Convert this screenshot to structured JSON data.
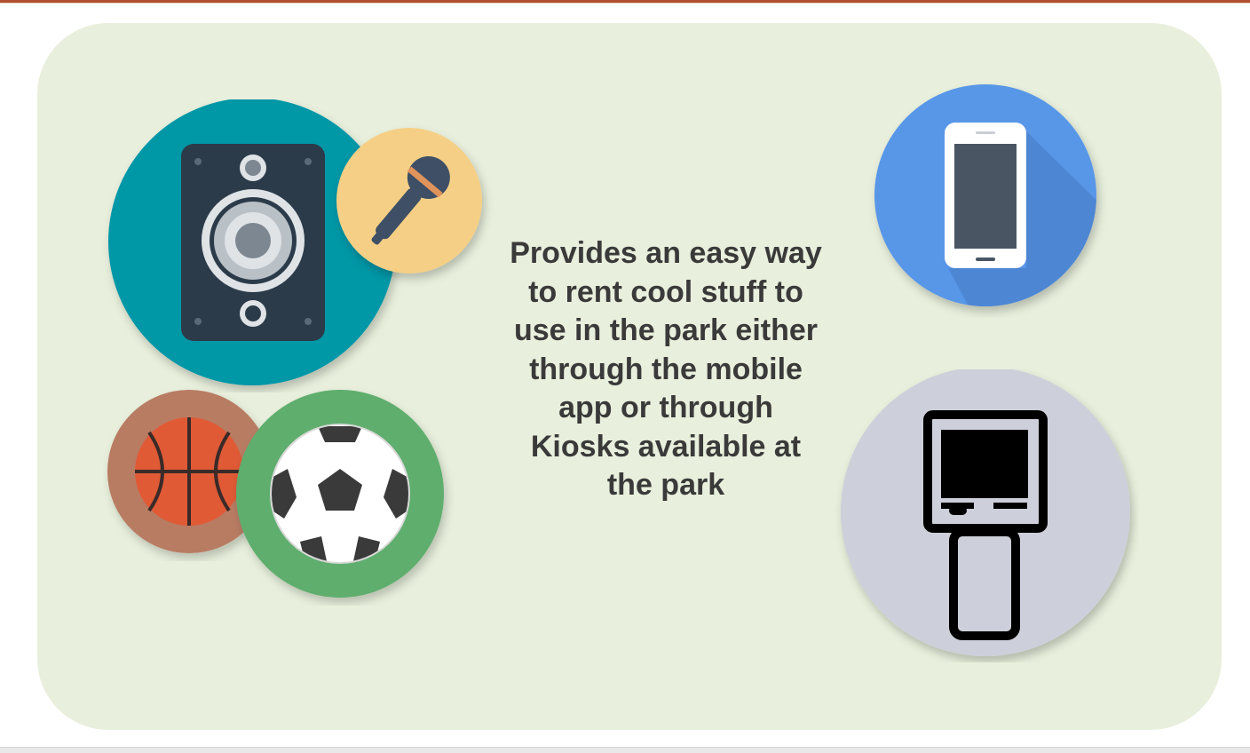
{
  "caption": "Provides an easy way\nto rent cool stuff to\nuse in the park either\nthrough the mobile\napp or through\nKiosks available at\nthe park",
  "icons": [
    {
      "name": "speaker-icon",
      "color": "#0097a7"
    },
    {
      "name": "microphone-icon",
      "color": "#f5cf85"
    },
    {
      "name": "basketball-icon",
      "color": "#b87b63"
    },
    {
      "name": "soccer-ball-icon",
      "color": "#5fae6e"
    },
    {
      "name": "mobile-phone-icon",
      "color": "#5897e8"
    },
    {
      "name": "kiosk-icon",
      "color": "#cdd0da"
    }
  ],
  "colors": {
    "panel": "#e8efdc",
    "text": "#3a3a3a",
    "top_rule": "#b0502f"
  }
}
